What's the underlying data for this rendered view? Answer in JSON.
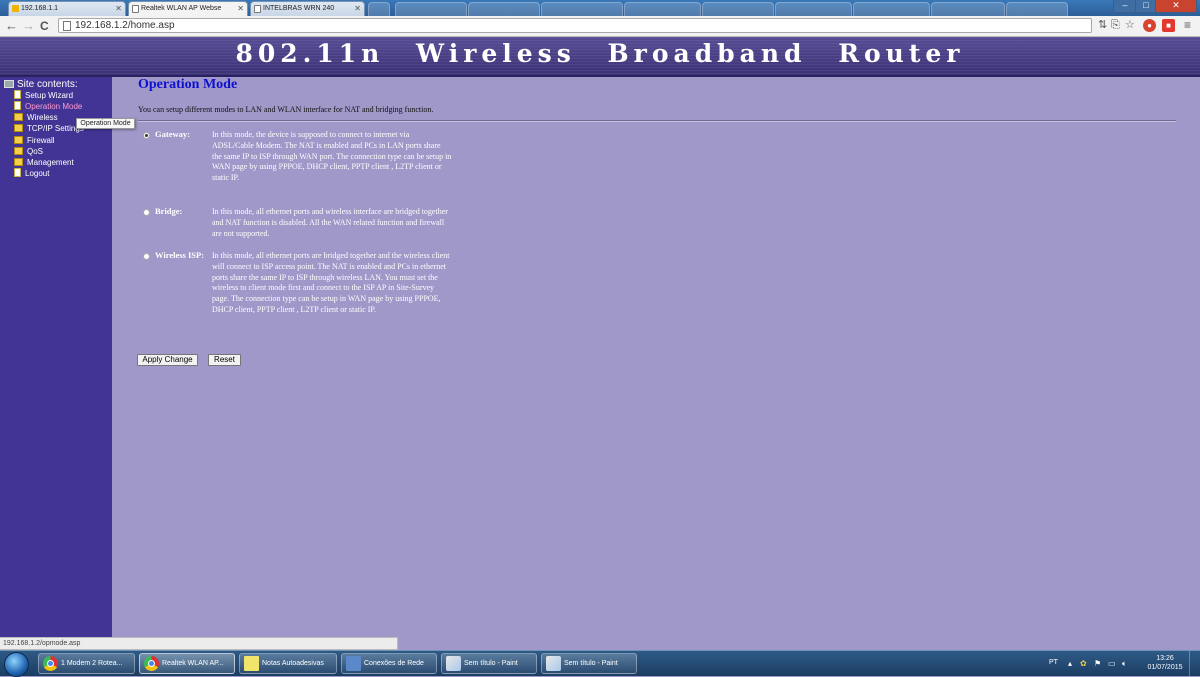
{
  "browser": {
    "tabs": [
      {
        "label": "192.168.1.1",
        "active": false
      },
      {
        "label": "Realtek WLAN AP Webse",
        "active": true
      },
      {
        "label": "INTELBRAS WRN 240",
        "active": false
      }
    ],
    "url": "192.168.1.2/home.asp",
    "status_url": "192.168.1.2/opmode.asp"
  },
  "header": {
    "title": "802.11n Wireless Broadband Router"
  },
  "sidebar": {
    "root_label": "Site contents:",
    "items": [
      {
        "label": "Setup Wizard",
        "icon": "page-icon"
      },
      {
        "label": "Operation Mode",
        "icon": "page-icon",
        "selected": true
      },
      {
        "label": "Wireless",
        "icon": "folder-icon"
      },
      {
        "label": "TCP/IP Settings",
        "icon": "folder-icon"
      },
      {
        "label": "Firewall",
        "icon": "folder-icon"
      },
      {
        "label": "QoS",
        "icon": "folder-icon"
      },
      {
        "label": "Management",
        "icon": "folder-icon"
      },
      {
        "label": "Logout",
        "icon": "page-icon"
      }
    ],
    "tooltip": "Operation Mode"
  },
  "main": {
    "title": "Operation Mode",
    "intro": "You can setup different modes to LAN and WLAN interface for NAT and bridging function.",
    "modes": [
      {
        "label": "Gateway:",
        "checked": true,
        "description": "In this mode, the device is supposed to connect to internet via ADSL/Cable Modem. The NAT is enabled and PCs in LAN ports share the same IP to ISP through WAN port. The connection type can be setup in WAN page by using PPPOE, DHCP client, PPTP client , L2TP client or static IP."
      },
      {
        "label": "Bridge:",
        "checked": false,
        "description": "In this mode, all ethernet ports and wireless interface are bridged together and NAT function is disabled. All the WAN related function and firewall are not supported."
      },
      {
        "label": "Wireless ISP:",
        "checked": false,
        "description": "In this mode, all ethernet ports are bridged together and the wireless client will connect to ISP access point. The NAT is enabled and PCs in ethernet ports share the same IP to ISP through wireless LAN. You must set the wireless to client mode first and connect to the ISP AP in Site-Survey page. The connection type can be setup in WAN page by using PPPOE, DHCP client, PPTP client , L2TP client or static IP."
      }
    ],
    "apply_label": "Apply Change",
    "reset_label": "Reset"
  },
  "taskbar": {
    "items": [
      {
        "label": "1 Modem 2 Rotea...",
        "icon": "chrome-icon"
      },
      {
        "label": "Realtek WLAN AP...",
        "icon": "chrome-icon"
      },
      {
        "label": "Notas Autoadesivas",
        "icon": "sticky-notes-icon"
      },
      {
        "label": "Conexões de Rede",
        "icon": "network-connections-icon"
      },
      {
        "label": "Sem título - Paint",
        "icon": "paint-icon"
      },
      {
        "label": "Sem título - Paint",
        "icon": "paint-icon"
      }
    ],
    "language": "PT",
    "time": "13:26",
    "date": "01/07/2015"
  }
}
